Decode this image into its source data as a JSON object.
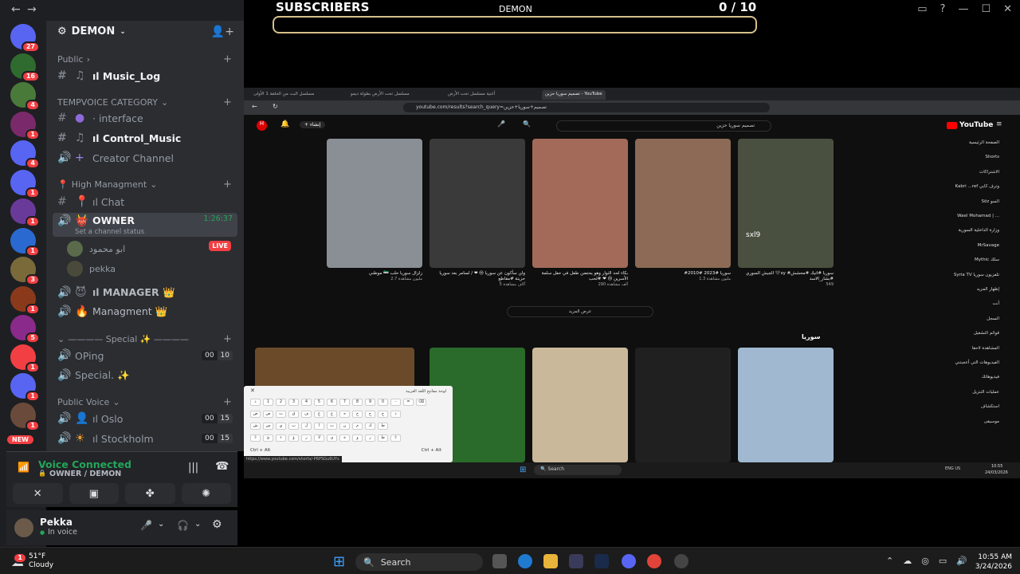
{
  "discord": {
    "server_name": "DEMON",
    "server_badges": [
      {
        "badge": "27",
        "color": "#5865f2"
      },
      {
        "badge": "16",
        "color": "#2f6b2f"
      },
      {
        "badge": "4",
        "color": "#4a7a3a"
      },
      {
        "badge": "1",
        "color": "#7a2a6a"
      },
      {
        "badge": "4",
        "color": "#5865f2"
      },
      {
        "badge": "1",
        "color": "#5865f2"
      },
      {
        "badge": "1",
        "color": "#6a3a9a"
      },
      {
        "badge": "1",
        "color": "#2a6ad0"
      },
      {
        "badge": "3",
        "color": "#7a6a3a"
      },
      {
        "badge": "1",
        "color": "#8a3a1a"
      },
      {
        "badge": "5",
        "color": "#8a2a8a"
      },
      {
        "badge": "1",
        "color": "#f23f43"
      },
      {
        "badge": "1",
        "color": "#5865f2"
      },
      {
        "badge": "1",
        "color": "#6a4a3a"
      }
    ],
    "new_label": "NEW",
    "categories": {
      "public": "Public",
      "tempvoice": "TEMPVOICE CATEGORY",
      "high": "High Managment",
      "special": "———— Special ✨ ————",
      "public_voice": "Public Voice"
    },
    "channels": {
      "music_log": "ıl Music_Log",
      "interface": "· interface",
      "control_music": "ıl Control_Music",
      "creator": "Creator Channel",
      "chat": "ıl Chat",
      "owner": "OWNER",
      "owner_status": "Set a channel status",
      "owner_timer": "1:26:37",
      "manager": "ıl MANAGER 👑",
      "managment": "Managment 👑",
      "oping": "OPing",
      "special": "Special. ✨",
      "oslo": "ıl Oslo",
      "stockholm": "ıl Stockholm"
    },
    "counts": {
      "oping": [
        "00",
        "10"
      ],
      "oslo": [
        "00",
        "15"
      ],
      "stockholm": [
        "00",
        "15"
      ]
    },
    "voice_users": {
      "user1": "ابو محمود",
      "user2": "pekka",
      "live": "LIVE"
    },
    "voice_connected": "Voice Connected",
    "voice_location": "OWNER / DEMON",
    "user_name": "Pekka",
    "user_status": "In voice"
  },
  "stream": {
    "subscribers_label": "SUBSCRIBERS",
    "channel_label": "DEMON",
    "score": "0  / 10",
    "progress": 0
  },
  "browser": {
    "tabs": [
      "مسلسل البت من الحلقة 1 الأولى",
      "مسلسل تحت الأرض بطولة ديمو",
      "أغنية مسلسل تحت الأرض",
      "تصميم سوريا حزين - YouTube"
    ],
    "url": "youtube.com/results?search_query=تصميم+سوريا+حزين",
    "search": "تصميم سوريا حزين",
    "create_label": "إنشاء",
    "yt_logo": "YouTube",
    "videos_row1": [
      {
        "title": "موطني 🇸🇾 زلزال سوريا حلب",
        "meta": "2.7 مليون مشاهدة",
        "color": "#8a8f96"
      },
      {
        "title": "ولن سأكون عن سوريا 😢 ❤ / لسامر بعد سوريا حزينة #مقاطع",
        "meta": "5 آلاف مشاهدة",
        "color": "#3a3a3a"
      },
      {
        "title": "بكاء لحد الثوار وهو يحتضن طفل في حفل سلمة الأسرين 😢 ❤ #لحب",
        "meta": "290 ألف مشاهدة",
        "color": "#a36a5a"
      },
      {
        "title": "#سوريا #2023 #2010",
        "meta": "1.3 مليون مشاهدة",
        "color": "#8c6a55"
      },
      {
        "title": "الجيش السوري 🖤sy #سوريا #اتيك #محشش #بشار_الاسد",
        "meta": "549",
        "color": "#4a5040",
        "overlay": "sxl9"
      }
    ],
    "more_label": "عرض المزيد",
    "section_title": "سوريا",
    "videos_row2_colors": [
      "#6b4a2a",
      "#2a6a2a",
      "#c9b89a",
      "#202020",
      "#a0b8d0"
    ],
    "sidebar": [
      "الصفحة الرئيسية",
      "Shorts",
      "الاشتراكات",
      "Kabri ...ref وترف كابي",
      "Söz السو",
      "Wael Mohamad | ...",
      "وزارة الداخلية السورية",
      "MrSavage",
      "Mythic سلك",
      "Syria TV تلفزيون سوريا",
      "إظهار المزيد",
      "أنت",
      "السجل",
      "قوائم التشغيل",
      "المشاهدة لاحقا",
      "الفيديوهات التي أعجبتني",
      "فيديوهاتك",
      "عمليات التنزيل",
      "استكشاف",
      "موسيقى"
    ],
    "keyboard_title": "لوحة مفاتيح اللغة العربية",
    "kbd_rows": [
      [
        "ذ",
        "1",
        "2",
        "3",
        "4",
        "5",
        "6",
        "7",
        "8",
        "9",
        "0",
        "-",
        "=",
        "⌫"
      ],
      [
        "ض",
        "ص",
        "ث",
        "ق",
        "ف",
        "غ",
        "ع",
        "ه",
        "خ",
        "ح",
        "ج",
        "د"
      ],
      [
        "ش",
        "س",
        "ي",
        "ب",
        "ل",
        "ا",
        "ت",
        "ن",
        "م",
        "ك",
        "ط"
      ],
      [
        "⇧",
        "ئ",
        "ء",
        "ؤ",
        "ر",
        "لا",
        "ى",
        "ة",
        "و",
        "ز",
        "ظ",
        "⇧"
      ]
    ],
    "kbd_ctrl_left": "Ctrl + Alt",
    "kbd_ctrl_right": "Ctrl + Alt",
    "status_url": "https://www.youtube.com/shorts/-P6PSGu6UYs",
    "inner_search": "Search",
    "inner_clock_time": "10:55",
    "inner_clock_date": "24/03/2026",
    "inner_lang": "ENG US"
  },
  "taskbar": {
    "temp": "51°F",
    "cond": "Cloudy",
    "weather_badge": "1",
    "search": "Search",
    "time": "10:55 AM",
    "date": "3/24/2026"
  }
}
